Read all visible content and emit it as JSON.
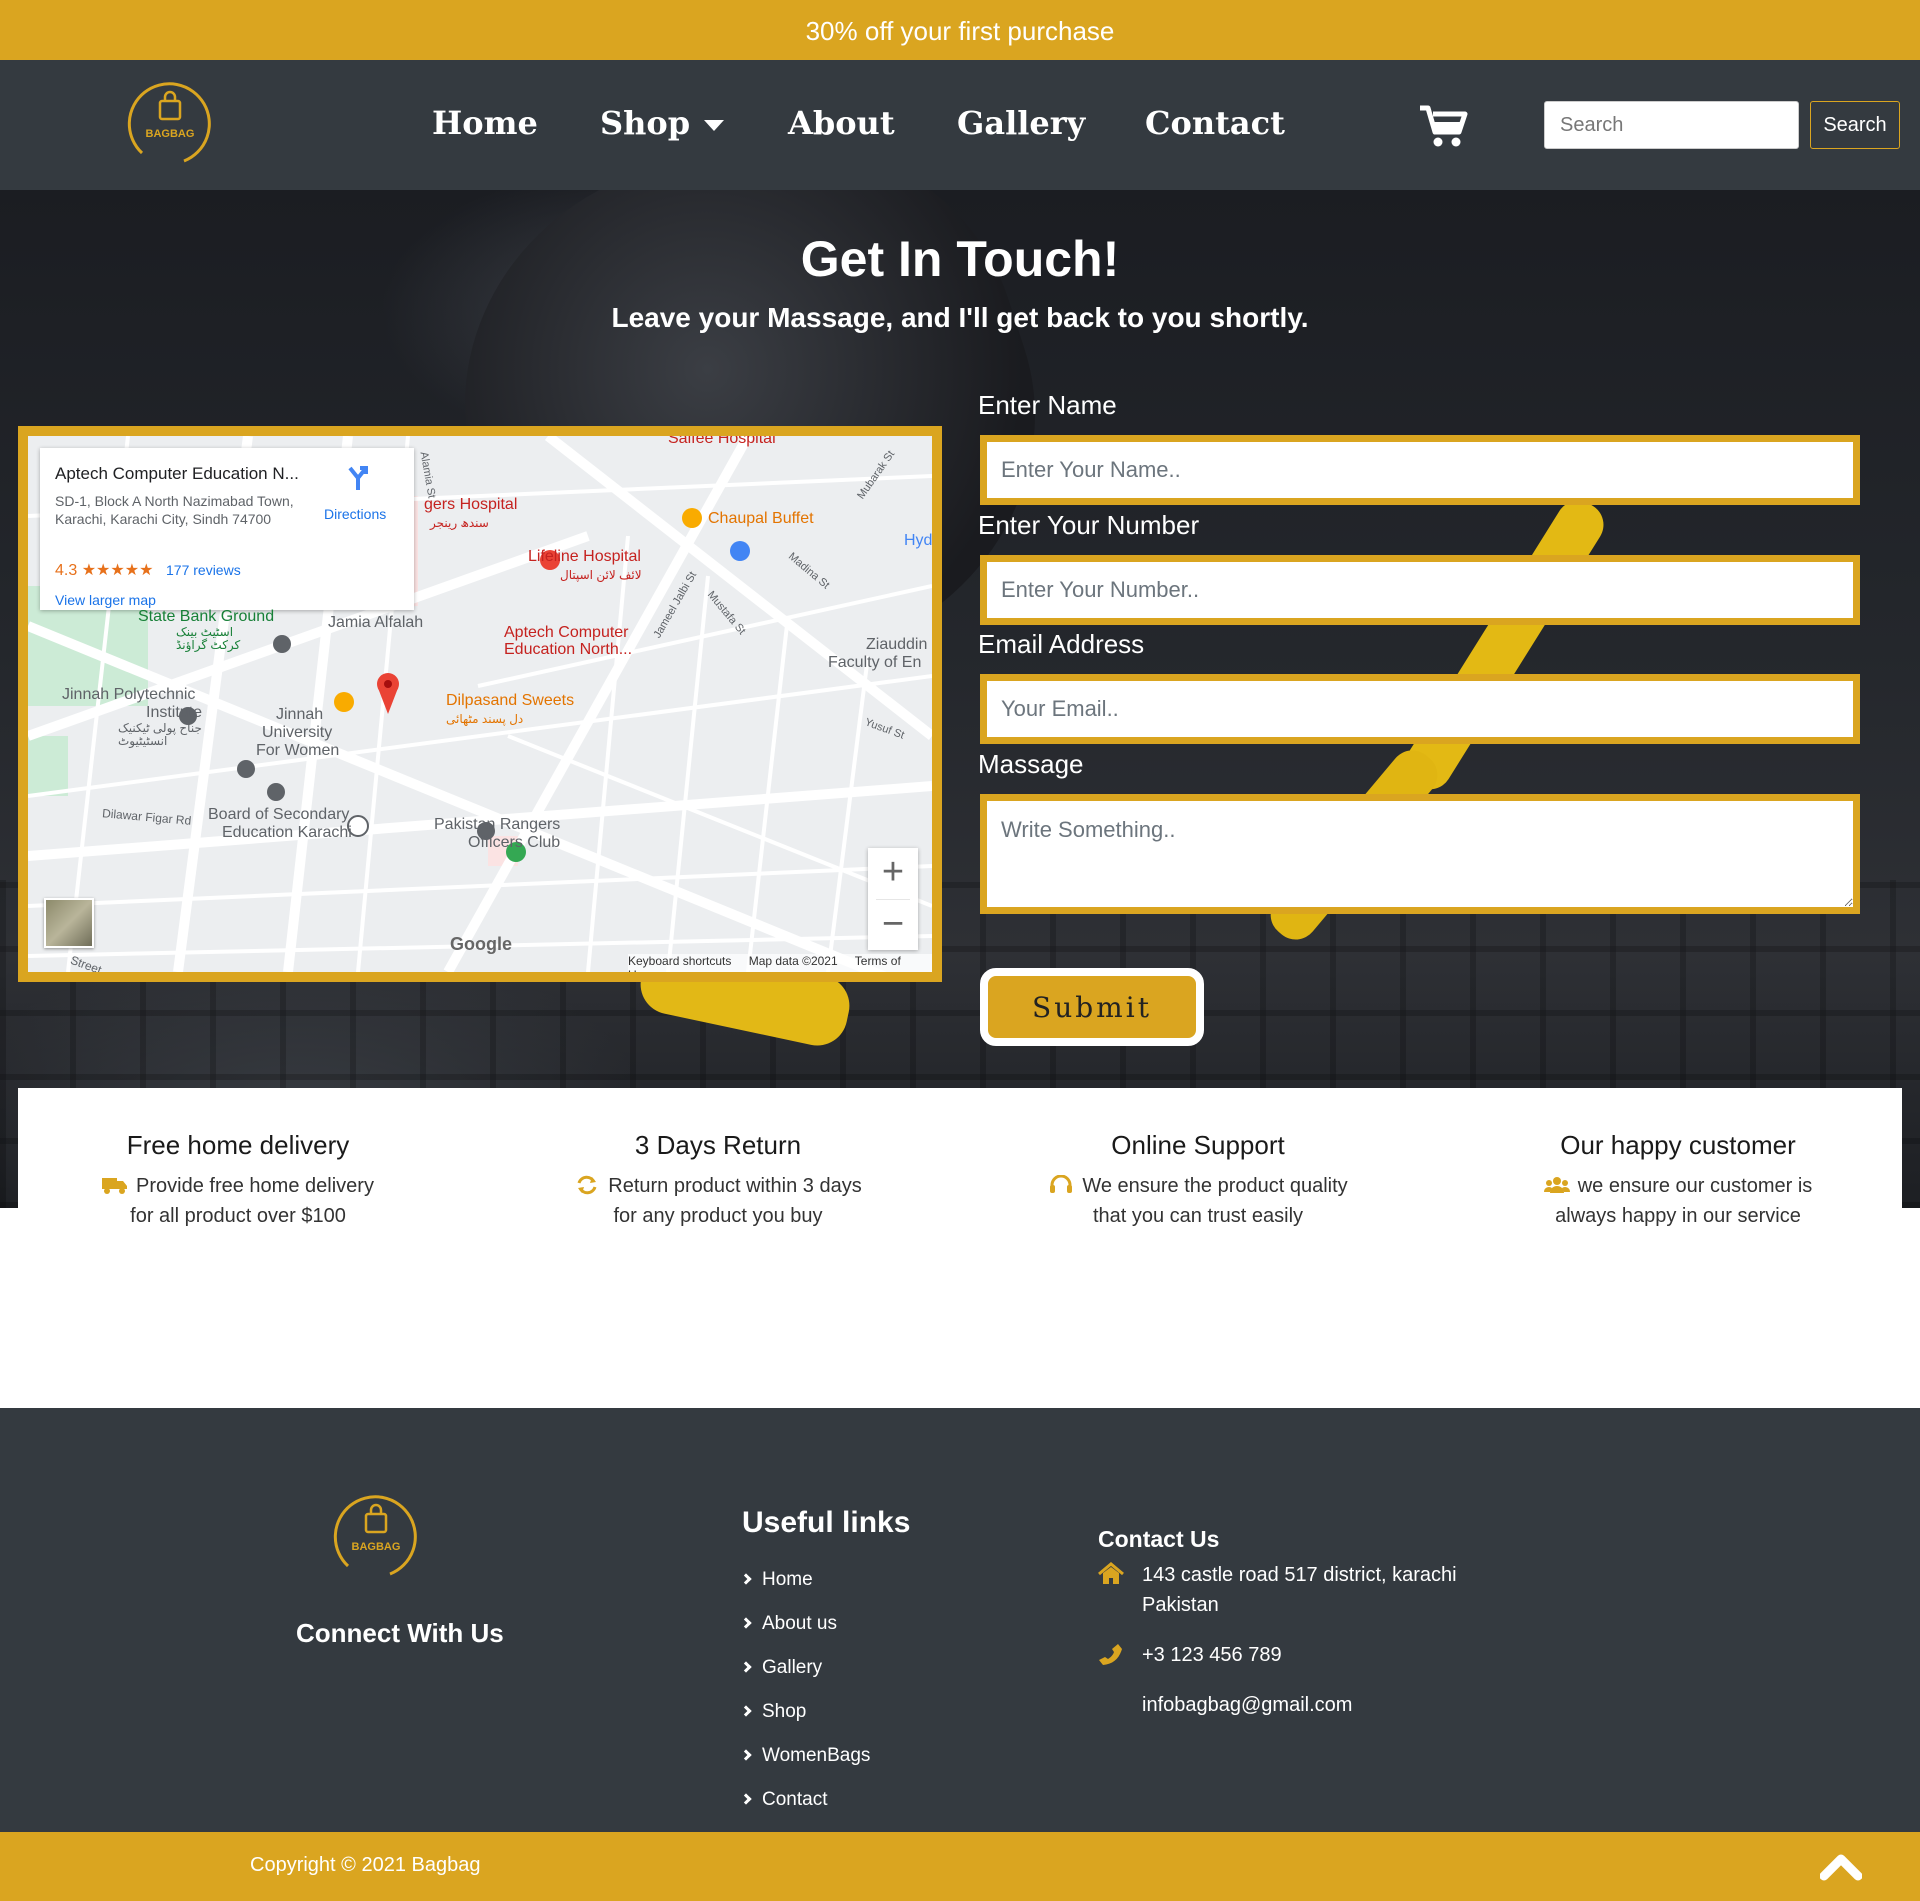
{
  "promo": {
    "text": "30% off your first purchase"
  },
  "brand": {
    "name": "BAGBAG",
    "accent": "#daa520",
    "dark": "#343a40"
  },
  "nav": {
    "links": [
      "Home",
      "Shop",
      "About",
      "Gallery",
      "Contact"
    ],
    "cart_icon": "shopping-cart-icon",
    "search_placeholder": "Search",
    "search_button": "Search"
  },
  "hero": {
    "title": "Get In Touch!",
    "subtitle": "Leave your Massage, and I'll get back to you shortly."
  },
  "map": {
    "place_name": "Aptech Computer Education N...",
    "address": "SD-1, Block A North Nazimabad Town, Karachi, Karachi City, Sindh 74700",
    "rating": "4.3",
    "stars": "★★★★★",
    "reviews": "177 reviews",
    "view_larger": "View larger map",
    "directions": "Directions",
    "labels": {
      "saifee": "Saifee Hospital",
      "rogers": "gers Hospital",
      "rogers_urdu": "سندھ رینجر",
      "chaupal": "Chaupal Buffet",
      "lifeline": "Lifeline Hospital",
      "lifeline_urdu": "لائف لائن اسپتال",
      "state_bank": "State Bank Ground",
      "state_bank_urdu": "اسٹیٹ بینک کرکٹ گراؤنڈ",
      "jamia": "Jamia Alfalah",
      "aptech_1": "Aptech Computer",
      "aptech_2": "Education North...",
      "ziauddin_1": "Ziauddin",
      "ziauddin_2": "Faculty of En",
      "jinnah_poly_1": "Jinnah Polytechnic",
      "jinnah_poly_2": "Institute",
      "jinnah_poly_urdu": "جناح پولی ٹیکنیک انسٹیٹیوٹ",
      "dilpasand": "Dilpasand Sweets",
      "dilpasand_urdu": "دل پسند مٹھائی",
      "jinnah_uni_1": "Jinnah",
      "jinnah_uni_2": "University",
      "jinnah_uni_3": "For Women",
      "board_1": "Board of Secondary",
      "board_2": "Education Karachi",
      "rangers_1": "Pakistan Rangers",
      "rangers_2": "Officers Club",
      "dilawar": "Dilawar Figar Rd",
      "street": "Street",
      "hyd": "Hyd",
      "mubarak": "Mubarak St",
      "madina": "Madina St",
      "jameel": "Jameel Jalbi St",
      "mustafa": "Mustafa St",
      "yusuf": "Yusuf St",
      "alamia": "Alamia St"
    },
    "google": "Google",
    "footer": [
      "Keyboard shortcuts",
      "Map data ©2021",
      "Terms of Use"
    ],
    "zoom_in": "+",
    "zoom_out": "−"
  },
  "form": {
    "name_label": "Enter Name",
    "name_placeholder": "Enter Your Name..",
    "number_label": "Enter Your Number",
    "number_placeholder": "Enter Your Number..",
    "email_label": "Email Address",
    "email_placeholder": "Your Email..",
    "message_label": "Massage",
    "message_placeholder": "Write Something..",
    "submit": "Submit"
  },
  "features": [
    {
      "title": "Free home delivery",
      "line1": "Provide free home delivery",
      "line2": "for all product over $100",
      "icon": "truck-icon"
    },
    {
      "title": "3 Days Return",
      "line1": "Return product within 3 days",
      "line2": "for any product you buy",
      "icon": "refresh-icon"
    },
    {
      "title": "Online Support",
      "line1": "We ensure the product quality",
      "line2": "that you can trust easily",
      "icon": "headset-icon"
    },
    {
      "title": "Our happy customer",
      "line1": "we ensure our customer is",
      "line2": "always happy in our service",
      "icon": "users-icon"
    }
  ],
  "footer": {
    "connect": "Connect With Us",
    "useful_title": "Useful links",
    "links": [
      "Home",
      "About us",
      "Gallery",
      "Shop",
      "WomenBags",
      "Contact"
    ],
    "contact_title": "Contact Us",
    "address": "143 castle road 517 district, karachi Pakistan",
    "phone": "+3 123 456 789",
    "email": "infobagbag@gmail.com",
    "copyright": "Copyright © 2021 Bagbag"
  }
}
